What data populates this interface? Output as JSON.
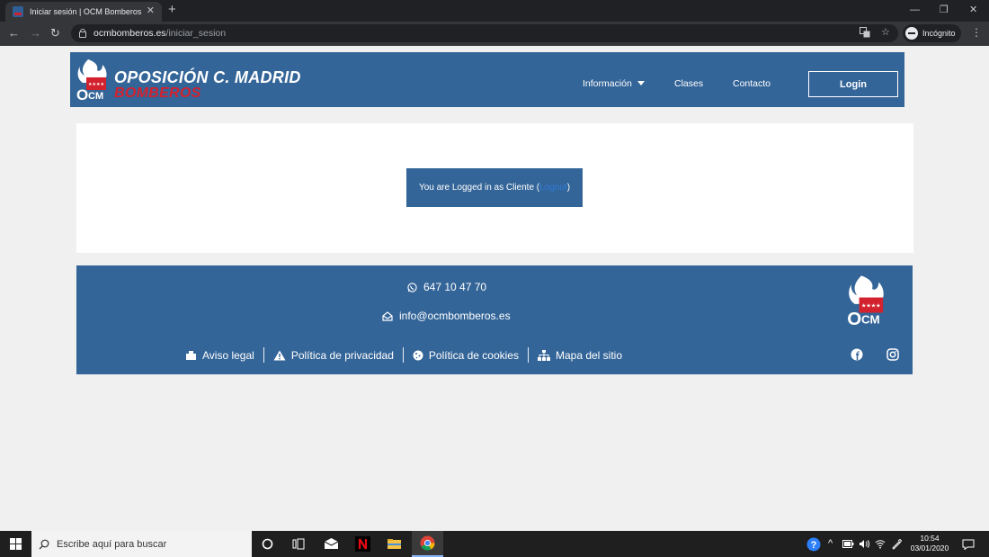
{
  "browser": {
    "tab_title": "Iniciar sesión | OCM Bomberos",
    "tab_close": "✕",
    "new_tab": "+",
    "url_host": "ocmbomberos.es",
    "url_path": "/iniciar_sesion",
    "incognito_label": "Incógnito",
    "window_controls": [
      "—",
      "❐",
      "✕"
    ],
    "nav": {
      "back": "←",
      "forward": "→",
      "reload": "↻"
    }
  },
  "header": {
    "brand_line1": "OPOSICIÓN C. MADRID",
    "brand_line2": "BOMBEROS",
    "logo_text": "OCM",
    "nav_items": [
      "Información",
      "Clases",
      "Contacto"
    ],
    "login_label": "Login"
  },
  "main": {
    "status_prefix": "You are Logged in as Cliente (",
    "logout_link": "Logout",
    "status_suffix": ")"
  },
  "footer": {
    "phone": "647 10 47 70",
    "email": "info@ocmbomberos.es",
    "links": [
      "Aviso legal",
      "Política de privacidad",
      "Política de cookies",
      "Mapa del sitio"
    ],
    "logo_text": "OCM"
  },
  "taskbar": {
    "search_placeholder": "Escribe aquí para buscar",
    "time": "10:54",
    "date": "03/01/2020"
  },
  "colors": {
    "brand_blue": "#346598",
    "brand_red": "#d3212d",
    "page_bg": "#f0f0f0",
    "link_blue": "#2f7ad8"
  }
}
